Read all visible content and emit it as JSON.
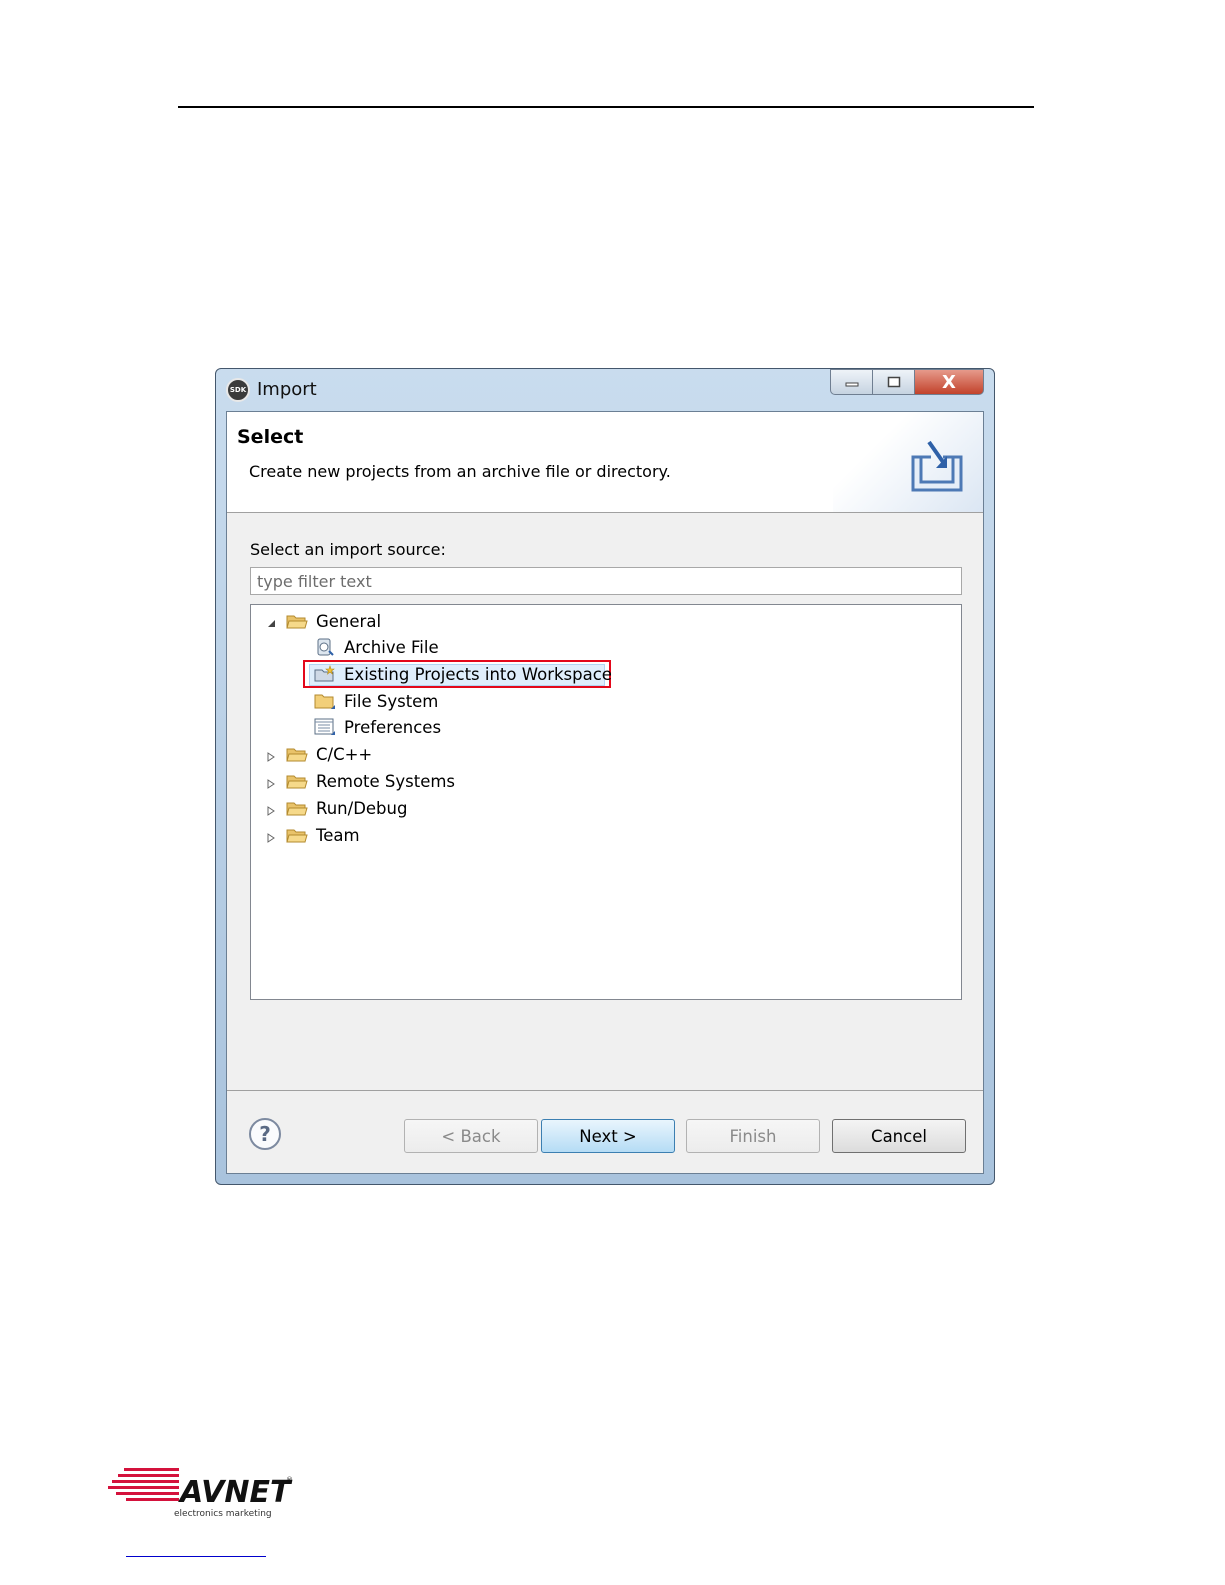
{
  "dialog": {
    "title": "Import",
    "app_icon_text": "SDK",
    "controls": {
      "minimize": "▭",
      "maximize": "◻",
      "close": "X"
    }
  },
  "banner": {
    "title": "Select",
    "description": "Create new projects from an archive file or directory.",
    "graphic_icon": "import-wizard-icon"
  },
  "source": {
    "label": "Select an import source:",
    "filter_placeholder": "type filter text",
    "filter_value": ""
  },
  "tree": {
    "items": [
      {
        "label": "General",
        "level": 0,
        "expanded": true,
        "icon": "folder-open-icon"
      },
      {
        "label": "Archive File",
        "level": 1,
        "icon": "archive-icon"
      },
      {
        "label": "Existing Projects into Workspace",
        "level": 1,
        "icon": "project-icon",
        "selected": true,
        "highlighted": true
      },
      {
        "label": "File System",
        "level": 1,
        "icon": "folder-icon"
      },
      {
        "label": "Preferences",
        "level": 1,
        "icon": "preferences-icon"
      },
      {
        "label": "C/C++",
        "level": 0,
        "expanded": false,
        "icon": "folder-open-icon"
      },
      {
        "label": "Remote Systems",
        "level": 0,
        "expanded": false,
        "icon": "folder-open-icon"
      },
      {
        "label": "Run/Debug",
        "level": 0,
        "expanded": false,
        "icon": "folder-open-icon"
      },
      {
        "label": "Team",
        "level": 0,
        "expanded": false,
        "icon": "folder-open-icon"
      }
    ],
    "highlight_color": "#e3081b"
  },
  "buttons": {
    "help": "?",
    "back": "< Back",
    "next": "Next >",
    "finish": "Finish",
    "cancel": "Cancel"
  },
  "footer": {
    "logo_text": "AVNET",
    "logo_tagline": "electronics marketing",
    "brand_color": "#d4123c"
  }
}
